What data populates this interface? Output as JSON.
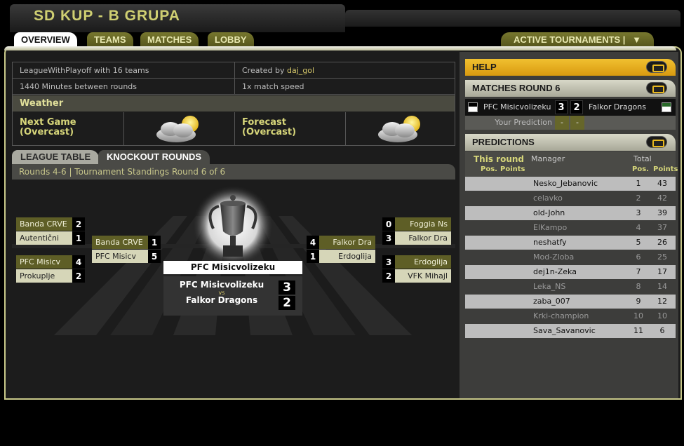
{
  "header": {
    "title": "SD KUP - B GRUPA"
  },
  "tabs": [
    {
      "label": "OVERVIEW"
    },
    {
      "label": "TEAMS"
    },
    {
      "label": "MATCHES"
    },
    {
      "label": "LOBBY"
    }
  ],
  "active_tournaments": {
    "label": "ACTIVE TOURNAMENTS |",
    "arrow": "▼"
  },
  "info": {
    "league": "LeagueWithPlayoff with 16 teams",
    "created_prefix": "Created by",
    "author": "daj_gol",
    "minutes": "1440 Minutes between rounds",
    "speed": "1x match speed"
  },
  "weather": {
    "title": "Weather",
    "next_label": "Next Game",
    "next_value": "(Overcast)",
    "forecast_label": "Forecast",
    "forecast_value": "(Overcast)"
  },
  "subtabs": {
    "league": "LEAGUE TABLE",
    "knockout": "KNOCKOUT ROUNDS"
  },
  "rounds_text": "Rounds 4-6 | Tournament Standings Round 6 of 6",
  "bracket": {
    "left_r1": [
      {
        "home": "Banda CRVE",
        "home_score": "2",
        "away": "Autentični",
        "away_score": "1"
      },
      {
        "home": "PFC Misicv",
        "home_score": "4",
        "away": "Prokuplje",
        "away_score": "2"
      }
    ],
    "left_r2": {
      "home": "Banda CRVE",
      "home_score": "1",
      "away": "PFC Misicv",
      "away_score": "5"
    },
    "right_r2": {
      "home": "Falkor Dra",
      "home_score": "4",
      "away": "Erdoglija",
      "away_score": "1"
    },
    "right_r1": [
      {
        "home": "Foggia Ns",
        "home_score": "0",
        "away": "Falkor Dra",
        "away_score": "3"
      },
      {
        "home": "Erdoglija",
        "home_score": "3",
        "away": "VFK Mihajl",
        "away_score": "2"
      }
    ],
    "winner": "PFC Misicvolizeku",
    "final": {
      "home": "PFC Misicvolizeku",
      "vs": "vs",
      "away": "Falkor Dragons",
      "home_score": "3",
      "away_score": "2"
    }
  },
  "help": {
    "title": "HELP"
  },
  "matches_round": {
    "title": "MATCHES ROUND 6",
    "home": "PFC Misicvolizeku",
    "home_score": "3",
    "away_score": "2",
    "away": "Falkor Dragons",
    "your_prediction_label": "Your Prediction",
    "pred_home": "-",
    "pred_away": "-"
  },
  "predictions": {
    "title": "PREDICTIONS",
    "this_round": "This round",
    "manager": "Manager",
    "total": "Total",
    "pos": "Pos.",
    "points": "Points",
    "rows": [
      {
        "manager": "Nesko_Jebanovic",
        "pos": "1",
        "points": "43"
      },
      {
        "manager": "celavko",
        "pos": "2",
        "points": "42"
      },
      {
        "manager": "old-John",
        "pos": "3",
        "points": "39"
      },
      {
        "manager": "ElKampo",
        "pos": "4",
        "points": "37"
      },
      {
        "manager": "neshatfy",
        "pos": "5",
        "points": "26"
      },
      {
        "manager": "Mod-Zloba",
        "pos": "6",
        "points": "25"
      },
      {
        "manager": "dej1n-Zeka",
        "pos": "7",
        "points": "17"
      },
      {
        "manager": "Leka_NS",
        "pos": "8",
        "points": "14"
      },
      {
        "manager": "zaba_007",
        "pos": "9",
        "points": "12"
      },
      {
        "manager": "Krki-champion",
        "pos": "10",
        "points": "10"
      },
      {
        "manager": "Sava_Savanovic",
        "pos": "11",
        "points": "6"
      }
    ]
  }
}
